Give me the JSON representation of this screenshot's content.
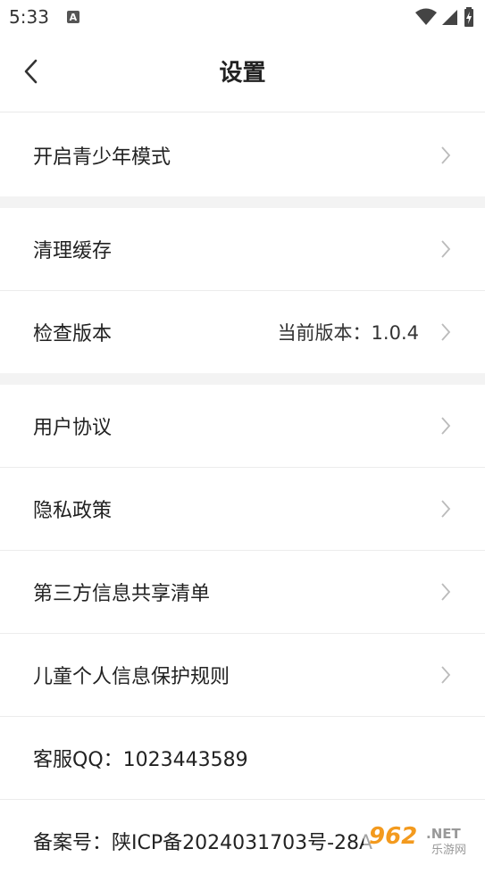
{
  "status_bar": {
    "time": "5:33",
    "notif_letter": "A"
  },
  "header": {
    "title": "设置"
  },
  "items": [
    {
      "label": "开启青少年模式"
    },
    {
      "label": "清理缓存"
    },
    {
      "label": "检查版本",
      "value": "当前版本：1.0.4"
    },
    {
      "label": "用户协议"
    },
    {
      "label": "隐私政策"
    },
    {
      "label": "第三方信息共享清单"
    },
    {
      "label": "儿童个人信息保护规则"
    },
    {
      "label": "客服QQ：1023443589"
    },
    {
      "label": "备案号：陕ICP备2024031703号-28A"
    }
  ],
  "watermark": {
    "brand": "962",
    "suffix": ".NET",
    "cn": "乐游网"
  },
  "colors": {
    "separator": "#f3f3f3",
    "chevron": "#bbbbbb",
    "watermark_orange": "#f39a1e"
  }
}
